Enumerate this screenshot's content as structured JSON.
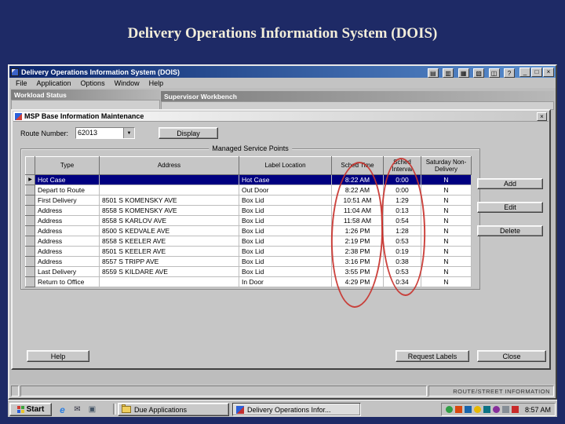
{
  "slide": {
    "title": "Delivery Operations Information System (DOIS)"
  },
  "colors": {
    "slide_bg": "#1e2a66",
    "titlebar_blue": "#0a246a",
    "selection": "#000080",
    "annotation_red": "#c8312b",
    "window_gray": "#c3c3c3"
  },
  "app": {
    "title": "Delivery Operations Information System (DOIS)",
    "menu": [
      "File",
      "Application",
      "Options",
      "Window",
      "Help"
    ],
    "titlebar_tools": [
      {
        "name": "status-tool-icon",
        "glyph": "▤"
      },
      {
        "name": "routes-tool-icon",
        "glyph": "▥"
      },
      {
        "name": "reports-tool-icon",
        "glyph": "▦"
      },
      {
        "name": "charts-tool-icon",
        "glyph": "▧"
      },
      {
        "name": "window-tool-icon",
        "glyph": "◫"
      },
      {
        "name": "help-tool-icon",
        "glyph": "?"
      }
    ],
    "caption_buttons": {
      "minimize": "_",
      "maximize": "□",
      "close": "×"
    },
    "child_windows": [
      {
        "title": "Workload Status"
      },
      {
        "title": "Supervisor Workbench"
      }
    ],
    "statusbar_text": "ROUTE/STREET INFORMATION"
  },
  "dialog": {
    "title": "MSP Base Information Maintenance",
    "close_glyph": "×",
    "route_label": "Route Number:",
    "route_value": "62013",
    "dropdown_glyph": "▼",
    "display_button": "Display",
    "group_title": "Managed Service Points",
    "table": {
      "selector_glyph": "▶",
      "headers": [
        "Type",
        "Address",
        "Label Location",
        "Sched Time",
        "Sched Interval",
        "Saturday Non-Delivery"
      ],
      "selected_row": 0,
      "rows": [
        [
          "Hot Case",
          "",
          "Hot Case",
          "8:22 AM",
          "0:00",
          "N"
        ],
        [
          "Depart to Route",
          "",
          "Out Door",
          "8:22 AM",
          "0:00",
          "N"
        ],
        [
          "First Delivery",
          "8501 S KOMENSKY AVE",
          "Box Lid",
          "10:51 AM",
          "1:29",
          "N"
        ],
        [
          "Address",
          "8558 S KOMENSKY AVE",
          "Box Lid",
          "11:04 AM",
          "0:13",
          "N"
        ],
        [
          "Address",
          "8558 S KARLOV AVE",
          "Box Lid",
          "11:58 AM",
          "0:54",
          "N"
        ],
        [
          "Address",
          "8500 S KEDVALE AVE",
          "Box Lid",
          "1:26 PM",
          "1:28",
          "N"
        ],
        [
          "Address",
          "8558 S KEELER AVE",
          "Box Lid",
          "2:19 PM",
          "0:53",
          "N"
        ],
        [
          "Address",
          "8501 S KEELER AVE",
          "Box Lid",
          "2:38 PM",
          "0:19",
          "N"
        ],
        [
          "Address",
          "8557 S TRIPP AVE",
          "Box Lid",
          "3:16 PM",
          "0:38",
          "N"
        ],
        [
          "Last Delivery",
          "8559 S KILDARE AVE",
          "Box Lid",
          "3:55 PM",
          "0:53",
          "N"
        ],
        [
          "Return to Office",
          "",
          "In Door",
          "4:29 PM",
          "0:34",
          "N"
        ]
      ]
    },
    "side_buttons": [
      "Add",
      "Edit",
      "Delete"
    ],
    "help_button": "Help",
    "request_labels_button": "Request Labels",
    "close_button": "Close"
  },
  "taskbar": {
    "start_label": "Start",
    "quick_launch": [
      {
        "name": "internet-explorer-icon",
        "glyph": "e"
      },
      {
        "name": "outlook-express-icon",
        "glyph": "✉"
      },
      {
        "name": "show-desktop-icon",
        "glyph": "▣"
      }
    ],
    "task_buttons": [
      "Due Applications",
      "Delivery Operations Infor..."
    ],
    "tray_icons": [
      "network-icon",
      "volume-icon",
      "antivirus-icon",
      "scheduler-icon",
      "display-settings-icon",
      "printer-icon",
      "messenger-icon",
      "updates-icon"
    ],
    "clock": "8:57 AM"
  }
}
